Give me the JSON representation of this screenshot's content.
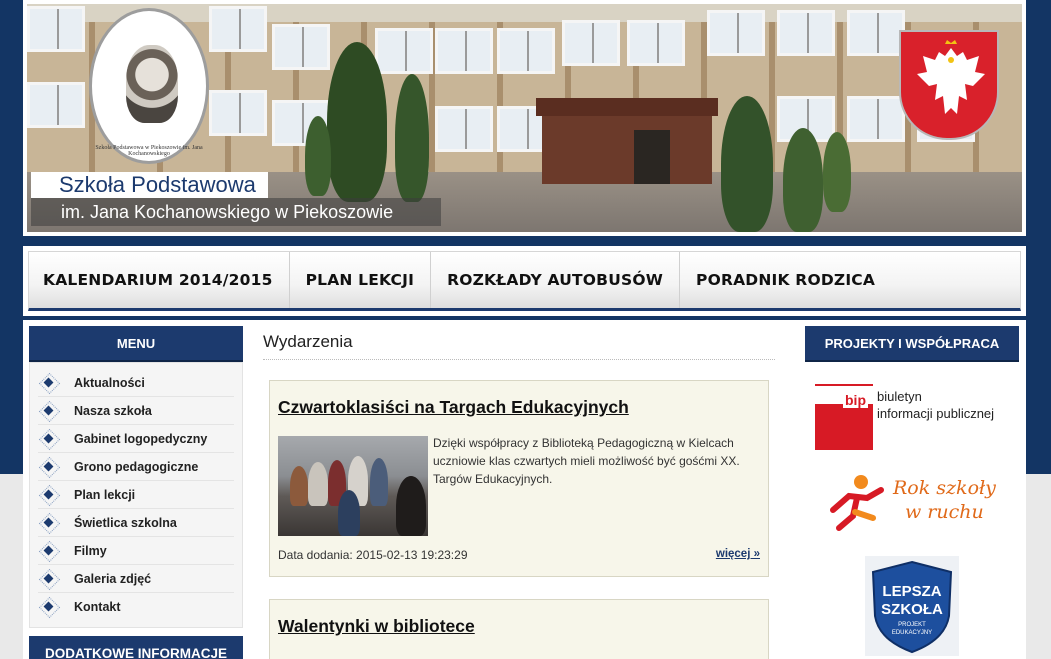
{
  "header": {
    "title_main": "Szkoła Podstawowa",
    "title_sub": "im. Jana Kochanowskiego w Piekoszowie",
    "logo_ring_text": "Szkoła Podstawowa w Piekoszowie im. Jana Kochanowskiego"
  },
  "nav": {
    "items": [
      "KALENDARIUM 2014/2015",
      "PLAN LEKCJI",
      "ROZKŁADY AUTOBUSÓW",
      "PORADNIK RODZICA"
    ]
  },
  "left_sidebar": {
    "menu_title": "MENU",
    "menu_items": [
      "Aktualności",
      "Nasza szkoła",
      "Gabinet logopedyczny",
      "Grono pedagogiczne",
      "Plan lekcji",
      "Świetlica szkolna",
      "Filmy",
      "Galeria zdjęć",
      "Kontakt"
    ],
    "second_title": "DODATKOWE INFORMACJE"
  },
  "main": {
    "section_title": "Wydarzenia",
    "articles": [
      {
        "title": "Czwartoklasiści na Targach Edukacyjnych",
        "text": "Dzięki współpracy z Biblioteką Pedagogiczną w Kielcach uczniowie klas czwartych mieli możliwość być gośćmi XX. Targów Edukacyjnych.",
        "date": "Data dodania: 2015-02-13 19:23:29",
        "more": "więcej »"
      },
      {
        "title": "Walentynki w bibliotece"
      }
    ]
  },
  "right_sidebar": {
    "title": "PROJEKTY I WSPÓŁPRACA",
    "partners": {
      "bip_label": "bip",
      "bip_line1": "biuletyn",
      "bip_line2": "informacji publicznej",
      "rok_line1": "Rok szkoły",
      "rok_line2": "w ruchu",
      "lepsza_line1": "LEPSZA",
      "lepsza_line2": "SZKOŁA",
      "lepsza_line3": "PROJEKT",
      "lepsza_line4": "EDUKACYJNY"
    }
  },
  "colors": {
    "navy": "#1c3a6e",
    "page_background": "#133564",
    "bip_red": "#d71a25",
    "rok_orange": "#e06a1a",
    "article_background": "#f7f6ea"
  }
}
